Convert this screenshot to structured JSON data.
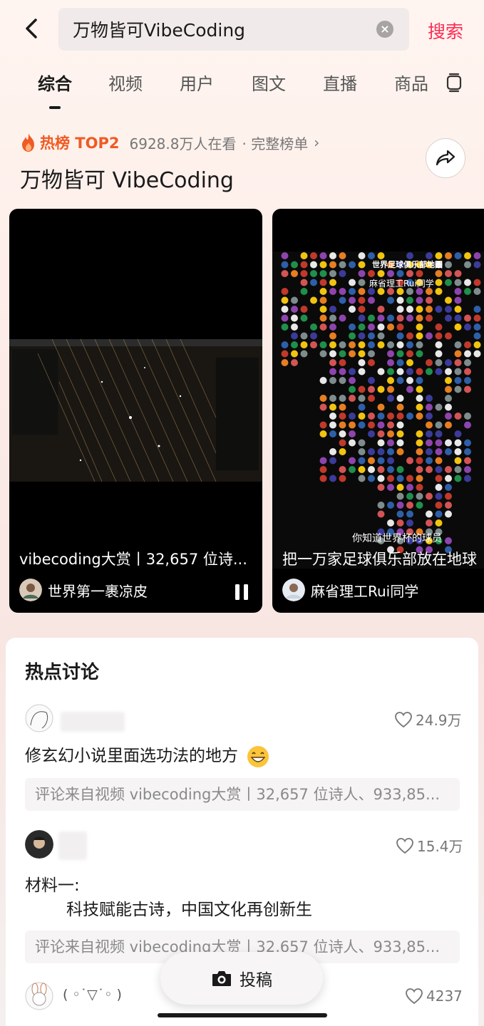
{
  "header": {
    "search_query": "万物皆可VibeCoding",
    "search_button": "搜索"
  },
  "tabs": [
    {
      "label": "综合",
      "active": true
    },
    {
      "label": "视频"
    },
    {
      "label": "用户"
    },
    {
      "label": "图文"
    },
    {
      "label": "直播"
    },
    {
      "label": "商品"
    }
  ],
  "hot": {
    "rank_label": "热榜 TOP2",
    "viewers": "6928.8万人在看",
    "full_list": "· 完整榜单",
    "topic_title": "万物皆可 VibeCoding"
  },
  "videos": [
    {
      "caption": "vibecoding大赏丨32,657 位诗...",
      "author": "世界第一裹凉皮",
      "playing": true
    },
    {
      "caption": "把一万家足球俱乐部放在地球",
      "author": "麻省理工Rui同学",
      "overlay_title": "世界足球俱乐部地图",
      "overlay_subtitle": "麻省理工Rui同学",
      "overlay_question": "你知道世界杯的球员"
    }
  ],
  "discussion": {
    "title": "热点讨论",
    "comments": [
      {
        "likes": "24.9万",
        "text": "修玄幻小说里面选功法的地方",
        "source": "评论来自视频 vibecoding大赏丨32,657 位诗人、933,85..."
      },
      {
        "likes": "15.4万",
        "text_line1": "材料一:",
        "text_line2": "科技赋能古诗，中国文化再创新生",
        "source": "评论来自视频 vibecoding大赏丨32,657 位诗人、933,85..."
      },
      {
        "username": "( ◦˙▽˙◦ )",
        "likes": "4237"
      }
    ]
  },
  "post": {
    "label": "投稿"
  },
  "colors": {
    "accent": "#fe2c55",
    "hot": "#f05a24"
  }
}
